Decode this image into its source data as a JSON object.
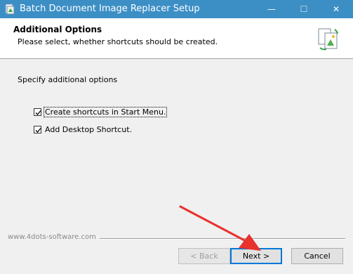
{
  "window": {
    "title": "Batch Document Image Replacer Setup",
    "controls": {
      "minimize": "—",
      "maximize": "☐",
      "close": "✕"
    }
  },
  "header": {
    "title": "Additional Options",
    "subtitle": "Please select, whether shortcuts should be created."
  },
  "body": {
    "instruction": "Specify additional options",
    "options": [
      {
        "label": "Create shortcuts in Start Menu.",
        "checked": true
      },
      {
        "label": "Add Desktop Shortcut.",
        "checked": true
      }
    ]
  },
  "footer": {
    "watermark": "www.4dots-software.com",
    "back_label": "< Back",
    "next_label": "Next >",
    "cancel_label": "Cancel"
  },
  "colors": {
    "titlebar": "#3c8fc5",
    "annotation_arrow": "#e8322e",
    "default_button_border": "#0078d7"
  },
  "icons": {
    "app": "installer-app-icon",
    "header": "document-replace-icon"
  }
}
